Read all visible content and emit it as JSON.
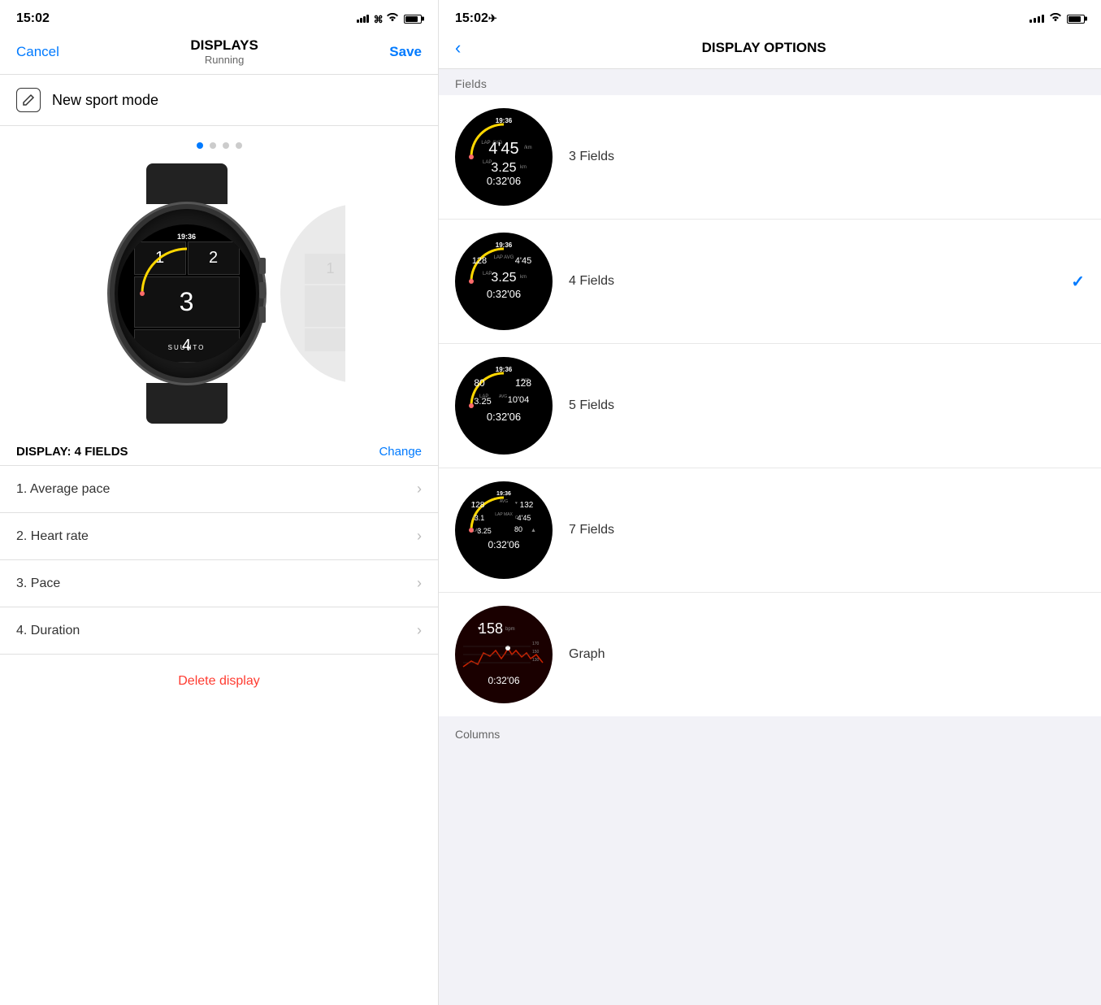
{
  "left": {
    "statusBar": {
      "time": "15:02",
      "locationIcon": "✈",
      "signalBars": 4,
      "wifi": true,
      "battery": true
    },
    "navBar": {
      "cancel": "Cancel",
      "title": "DISPLAYS",
      "subtitle": "Running",
      "save": "Save"
    },
    "sportMode": {
      "label": "New sport mode"
    },
    "dots": [
      true,
      false,
      false,
      false
    ],
    "displayInfo": {
      "label": "DISPLAY: 4 FIELDS",
      "changeBtn": "Change"
    },
    "fields": [
      {
        "number": "1.",
        "name": "Average pace"
      },
      {
        "number": "2.",
        "name": "Heart rate"
      },
      {
        "number": "3.",
        "name": "Pace"
      },
      {
        "number": "4.",
        "name": "Duration"
      }
    ],
    "deleteBtn": "Delete display",
    "watchNumbers": [
      "1",
      "2",
      "3",
      "4"
    ],
    "watchTime": "19:36"
  },
  "right": {
    "statusBar": {
      "time": "15:02"
    },
    "navBar": {
      "backIcon": "<",
      "title": "DISPLAY OPTIONS"
    },
    "sections": {
      "fields": "Fields",
      "columns": "Columns"
    },
    "options": [
      {
        "label": "3 Fields",
        "checked": false
      },
      {
        "label": "4 Fields",
        "checked": true
      },
      {
        "label": "5 Fields",
        "checked": false
      },
      {
        "label": "7 Fields",
        "checked": false
      },
      {
        "label": "Graph",
        "checked": false
      }
    ]
  }
}
